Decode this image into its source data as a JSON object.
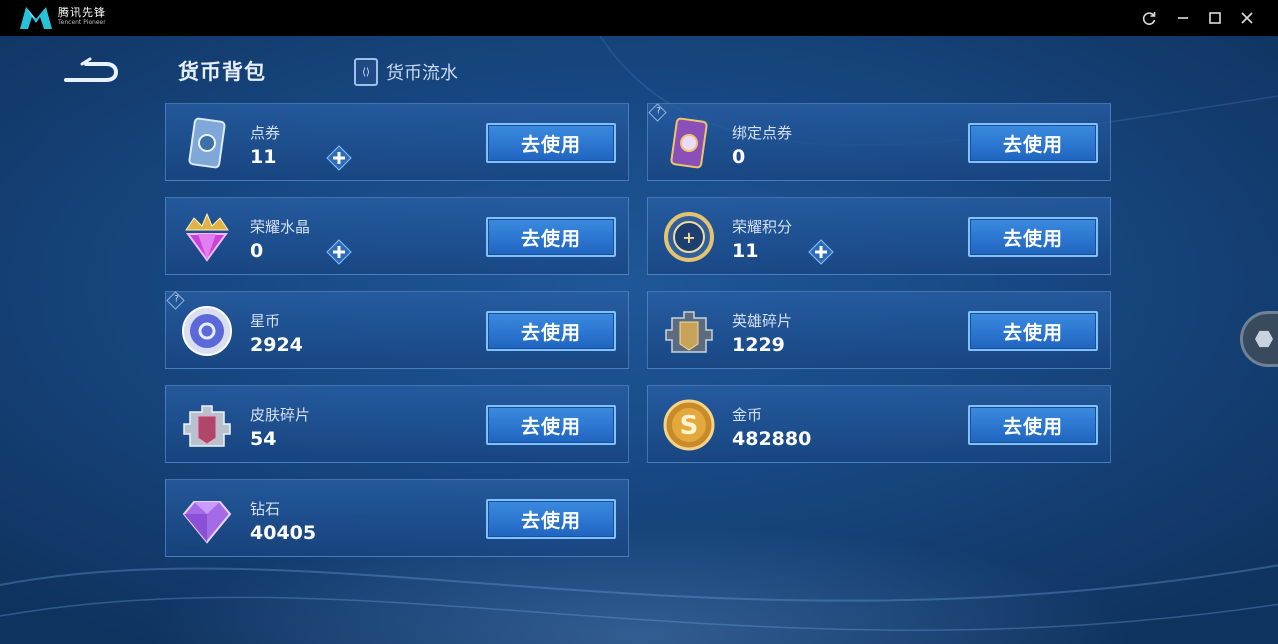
{
  "window": {
    "brand_cn": "腾讯先锋",
    "brand_en": "Tencent Pioneer",
    "controls": [
      "refresh-icon",
      "minimize-icon",
      "maximize-icon",
      "close-icon"
    ]
  },
  "header": {
    "tab_backpack": "货币背包",
    "tab_flow": "货币流水"
  },
  "use_label": "去使用",
  "currencies": [
    {
      "name": "点券",
      "value": "11",
      "icon": "ticket-icon",
      "plus": true,
      "help": false
    },
    {
      "name": "绑定点券",
      "value": "0",
      "icon": "bound-ticket-icon",
      "plus": false,
      "help": true
    },
    {
      "name": "荣耀水晶",
      "value": "0",
      "icon": "glory-crystal-icon",
      "plus": true,
      "help": false
    },
    {
      "name": "荣耀积分",
      "value": "11",
      "icon": "glory-points-icon",
      "plus": true,
      "help": false
    },
    {
      "name": "星币",
      "value": "2924",
      "icon": "star-coin-icon",
      "plus": false,
      "help": true
    },
    {
      "name": "英雄碎片",
      "value": "1229",
      "icon": "hero-fragment-icon",
      "plus": false,
      "help": false
    },
    {
      "name": "皮肤碎片",
      "value": "54",
      "icon": "skin-fragment-icon",
      "plus": false,
      "help": false
    },
    {
      "name": "金币",
      "value": "482880",
      "icon": "gold-coin-icon",
      "plus": false,
      "help": false
    },
    {
      "name": "钻石",
      "value": "40405",
      "icon": "diamond-icon",
      "plus": false,
      "help": false
    }
  ],
  "colors": {
    "button": "#2a75d0",
    "button_border": "#7fc0ff",
    "background": "#184a86"
  }
}
